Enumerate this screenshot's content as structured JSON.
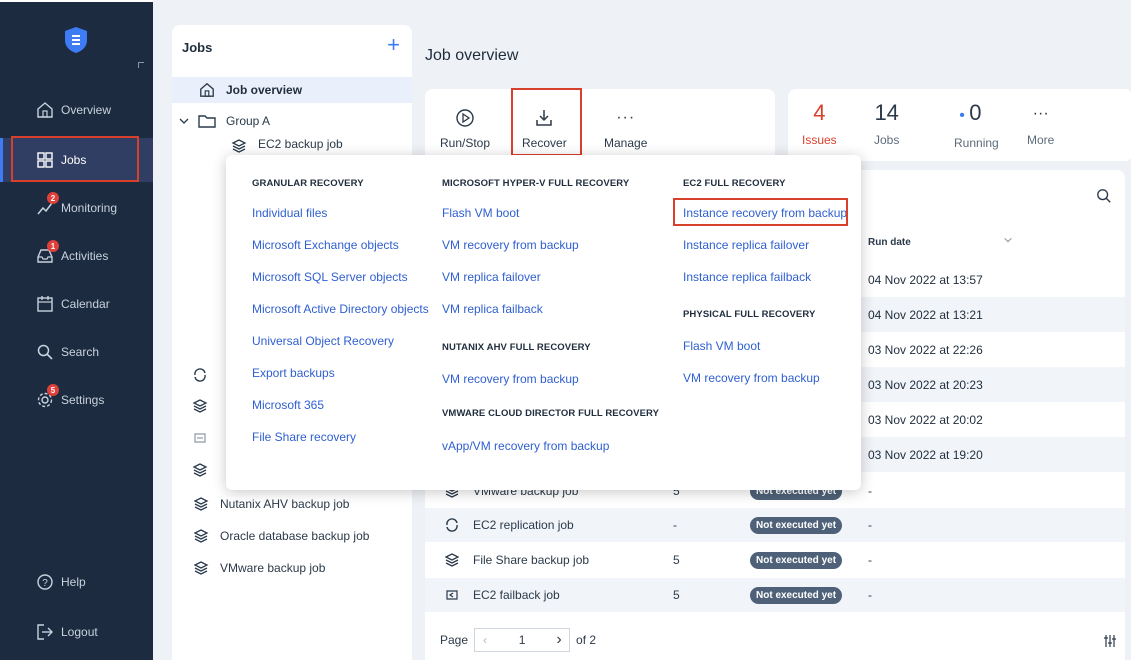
{
  "sidebar": {
    "items": [
      {
        "label": "Overview",
        "icon": "home-icon"
      },
      {
        "label": "Jobs",
        "icon": "grid-icon",
        "active": true
      },
      {
        "label": "Monitoring",
        "icon": "chart-icon",
        "badge": "2"
      },
      {
        "label": "Activities",
        "icon": "inbox-icon",
        "badge": "1"
      },
      {
        "label": "Calendar",
        "icon": "calendar-icon"
      },
      {
        "label": "Search",
        "icon": "search-icon"
      },
      {
        "label": "Settings",
        "icon": "gear-icon",
        "badge": "5"
      }
    ],
    "help": "Help",
    "logout": "Logout"
  },
  "jobs_panel": {
    "title": "Jobs",
    "add": "+",
    "overview": "Job overview",
    "group": "Group A",
    "partial": "EC2 backup job",
    "items": [
      "Nutanix AHV backup job",
      "Oracle database backup job",
      "VMware backup job"
    ]
  },
  "main": {
    "title": "Job overview",
    "toolbar": {
      "run_stop": "Run/Stop",
      "recover": "Recover",
      "manage": "Manage"
    },
    "stats": {
      "issues_num": "4",
      "issues_label": "Issues",
      "jobs_num": "14",
      "jobs_label": "Jobs",
      "running_num": "0",
      "running_label": "Running",
      "more_label": "More"
    },
    "column_run_date": "Run date",
    "run_dates": [
      "04 Nov 2022 at 13:57",
      "04 Nov 2022 at 13:21",
      "03 Nov 2022 at 22:26",
      "03 Nov 2022 at 20:23",
      "03 Nov 2022 at 20:02",
      "03 Nov 2022 at 19:20"
    ],
    "rows": [
      {
        "name": "VMware backup job",
        "count": "5",
        "status": "Not executed yet",
        "run": "-"
      },
      {
        "name": "EC2 replication job",
        "count": "-",
        "status": "Not executed yet",
        "run": "-"
      },
      {
        "name": "File Share backup job",
        "count": "5",
        "status": "Not executed yet",
        "run": "-"
      },
      {
        "name": "EC2 failback job",
        "count": "5",
        "status": "Not executed yet",
        "run": "-"
      }
    ],
    "pager": {
      "label": "Page",
      "value": "1",
      "of": "of 2"
    }
  },
  "dropdown": {
    "granular_head": "GRANULAR RECOVERY",
    "granular": [
      "Individual files",
      "Microsoft Exchange objects",
      "Microsoft SQL Server objects",
      "Microsoft Active Directory objects",
      "Universal Object Recovery",
      "Export backups",
      "Microsoft 365",
      "File Share recovery"
    ],
    "hyperv_head": "MICROSOFT HYPER-V FULL RECOVERY",
    "hyperv": [
      "Flash VM boot",
      "VM recovery from backup",
      "VM replica failover",
      "VM replica failback"
    ],
    "nutanix_head": "NUTANIX AHV FULL RECOVERY",
    "nutanix": [
      "VM recovery from backup"
    ],
    "vcd_head": "VMWARE CLOUD DIRECTOR FULL RECOVERY",
    "vcd": [
      "vApp/VM recovery from backup"
    ],
    "ec2_head": "EC2 FULL RECOVERY",
    "ec2": [
      "Instance recovery from backup",
      "Instance replica failover",
      "Instance replica failback"
    ],
    "physical_head": "PHYSICAL FULL RECOVERY",
    "physical": [
      "Flash VM boot",
      "VM recovery from backup"
    ]
  },
  "colors": {
    "accent": "#3d7cf4",
    "highlight": "#d9402b",
    "issues": "#d9402b",
    "sidebar": "#1c2b3f"
  }
}
